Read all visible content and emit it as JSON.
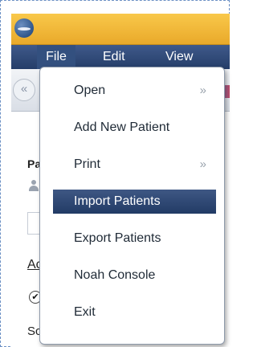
{
  "menu": {
    "file": "File",
    "edit": "Edit",
    "view": "View"
  },
  "background": {
    "label_pa": "Pa",
    "label_ac": "Ac",
    "label_sc": "Sc",
    "nav_back_glyph": "«",
    "check_glyph": "✔"
  },
  "dropdown": {
    "items": [
      {
        "label": "Open",
        "submenu_glyph": "»"
      },
      {
        "label": "Add New Patient"
      },
      {
        "label": "Print",
        "submenu_glyph": "»"
      },
      {
        "label": "Import Patients",
        "highlighted": true
      },
      {
        "label": "Export Patients"
      },
      {
        "label": "Noah Console"
      },
      {
        "label": "Exit"
      }
    ]
  },
  "colors": {
    "title_bar": "#f2b73a",
    "menu_bar": "#2f4a78",
    "highlight": "#2e4a76"
  }
}
